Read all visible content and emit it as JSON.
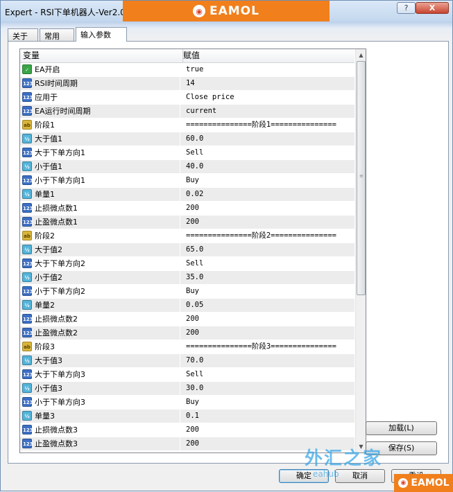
{
  "window": {
    "title": "Expert - RSI下单机器人-Ver2.0",
    "help_glyph": "?",
    "close_glyph": "X",
    "watermark_brand": "EAMOL",
    "watermark_cn": "外汇之家",
    "watermark_site": "eahub"
  },
  "tabs": [
    {
      "label": "关于"
    },
    {
      "label": "常用"
    },
    {
      "label": "输入参数"
    }
  ],
  "grid": {
    "col_variable": "变量",
    "col_value": "赋值",
    "rows": [
      {
        "type": "bool",
        "name": "EA开启",
        "value": "true"
      },
      {
        "type": "int",
        "name": "RSI时间周期",
        "value": "14"
      },
      {
        "type": "int",
        "name": "应用于",
        "value": "Close price"
      },
      {
        "type": "int",
        "name": "EA运行时间周期",
        "value": "current"
      },
      {
        "type": "str",
        "name": "阶段1",
        "value": "===============阶段1==============="
      },
      {
        "type": "dbl",
        "name": "大于值1",
        "value": "60.0"
      },
      {
        "type": "int",
        "name": "大于下单方向1",
        "value": "Sell"
      },
      {
        "type": "dbl",
        "name": "小于值1",
        "value": "40.0"
      },
      {
        "type": "int",
        "name": "小于下单方向1",
        "value": "Buy"
      },
      {
        "type": "dbl",
        "name": "单量1",
        "value": "0.02"
      },
      {
        "type": "int",
        "name": "止损微点数1",
        "value": "200"
      },
      {
        "type": "int",
        "name": "止盈微点数1",
        "value": "200"
      },
      {
        "type": "str",
        "name": "阶段2",
        "value": "===============阶段2==============="
      },
      {
        "type": "dbl",
        "name": "大于值2",
        "value": "65.0"
      },
      {
        "type": "int",
        "name": "大于下单方向2",
        "value": "Sell"
      },
      {
        "type": "dbl",
        "name": "小于值2",
        "value": "35.0"
      },
      {
        "type": "int",
        "name": "小于下单方向2",
        "value": "Buy"
      },
      {
        "type": "dbl",
        "name": "单量2",
        "value": "0.05"
      },
      {
        "type": "int",
        "name": "止损微点数2",
        "value": "200"
      },
      {
        "type": "int",
        "name": "止盈微点数2",
        "value": "200"
      },
      {
        "type": "str",
        "name": "阶段3",
        "value": "===============阶段3==============="
      },
      {
        "type": "dbl",
        "name": "大于值3",
        "value": "70.0"
      },
      {
        "type": "int",
        "name": "大于下单方向3",
        "value": "Sell"
      },
      {
        "type": "dbl",
        "name": "小于值3",
        "value": "30.0"
      },
      {
        "type": "int",
        "name": "小于下单方向3",
        "value": "Buy"
      },
      {
        "type": "dbl",
        "name": "单量3",
        "value": "0.1"
      },
      {
        "type": "int",
        "name": "止损微点数3",
        "value": "200"
      },
      {
        "type": "int",
        "name": "止盈微点数3",
        "value": "200"
      }
    ]
  },
  "type_icons": {
    "bool": {
      "icon": "bool-param-icon",
      "glyph": "✓",
      "color": "#3aa546"
    },
    "int": {
      "icon": "int-param-icon",
      "glyph": "123",
      "color": "#3c6fc4"
    },
    "str": {
      "icon": "string-param-icon",
      "glyph": "ab",
      "color": "#d8b53b"
    },
    "dbl": {
      "icon": "double-param-icon",
      "glyph": "½",
      "color": "#53b3d9"
    }
  },
  "buttons": {
    "load": "加载(L)",
    "save": "保存(S)",
    "ok": "确定",
    "cancel": "取消",
    "reset": "重设"
  }
}
